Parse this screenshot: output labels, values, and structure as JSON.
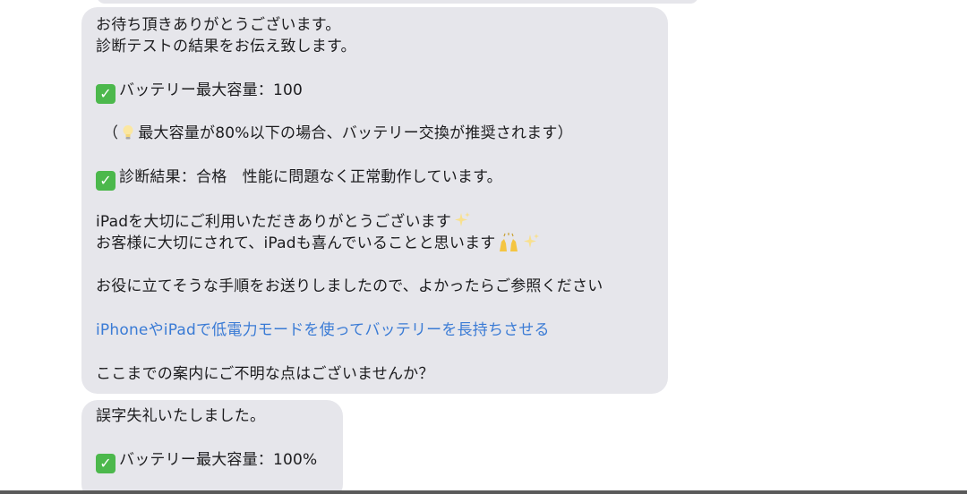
{
  "messages": [
    {
      "lines": {
        "l1": "お待ち頂きありがとうございます。",
        "l2": "診断テストの結果をお伝え致します。",
        "l3": "バッテリー最大容量：100",
        "l4_open": "（",
        "l4_text": "最大容量が80%以下の場合、バッテリー交換が推奨されます）",
        "l5": "診断結果：合格　性能に問題なく正常動作しています。",
        "l6": "iPadを大切にご利用いただきありがとうございます",
        "l7": "お客様に大切にされて、iPadも喜んでいることと思います",
        "l8": "お役に立てそうな手順をお送りしましたので、よかったらご参照ください",
        "link": "iPhoneやiPadで低電力モードを使ってバッテリーを長持ちさせる",
        "l9": "ここまでの案内にご不明な点はございませんか？"
      }
    },
    {
      "lines": {
        "l1": "誤字失礼いたしました。",
        "l2": "バッテリー最大容量：100%"
      }
    }
  ],
  "icons": {
    "check": "✓",
    "check_color": "#4cb84c",
    "bubble_color": "#e6e6eb",
    "link_color": "#3a7bd5"
  }
}
